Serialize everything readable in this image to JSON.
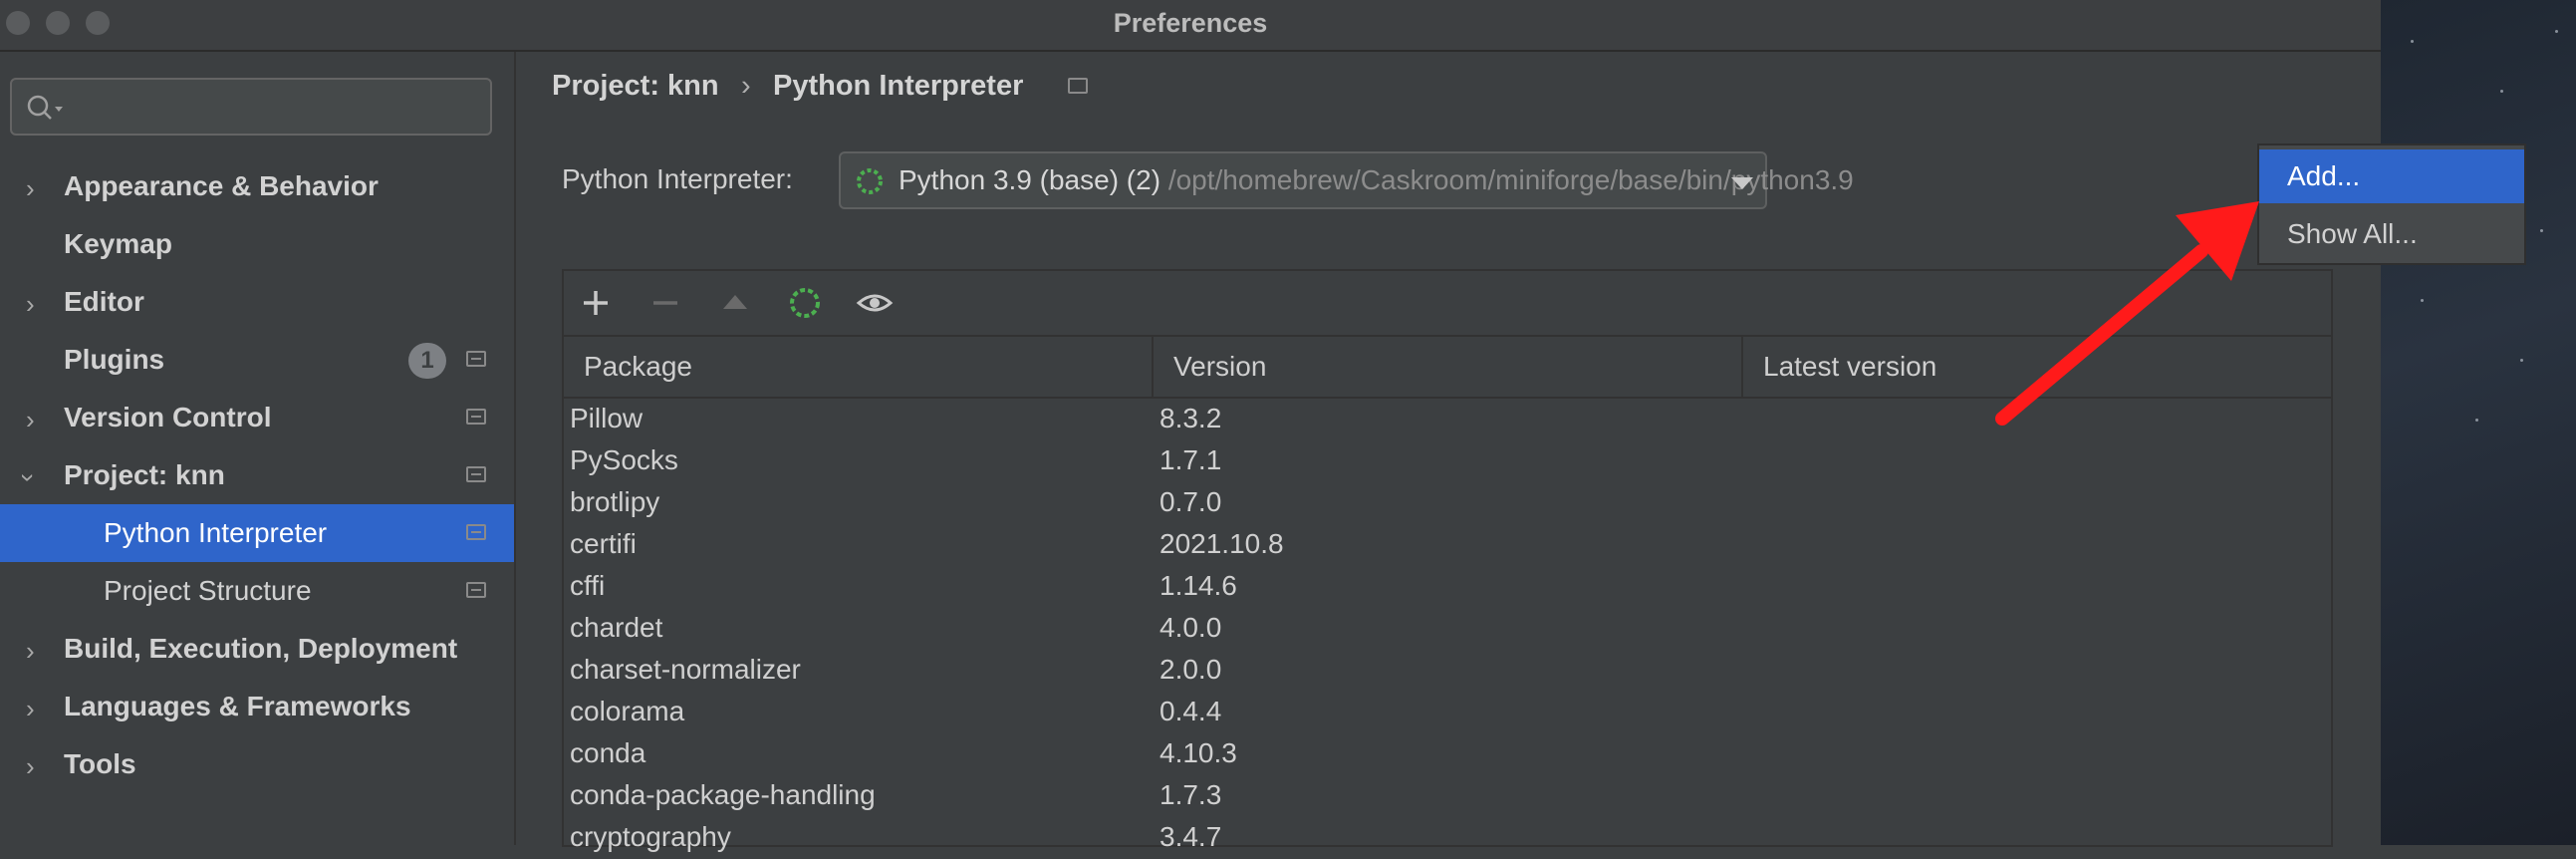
{
  "window": {
    "title": "Preferences"
  },
  "sidebar": {
    "search_placeholder": "",
    "items": [
      {
        "label": "Appearance & Behavior"
      },
      {
        "label": "Keymap"
      },
      {
        "label": "Editor"
      },
      {
        "label": "Plugins",
        "badge": "1"
      },
      {
        "label": "Version Control"
      },
      {
        "label": "Project: knn"
      },
      {
        "label": "Python Interpreter"
      },
      {
        "label": "Project Structure"
      },
      {
        "label": "Build, Execution, Deployment"
      },
      {
        "label": "Languages & Frameworks"
      },
      {
        "label": "Tools"
      }
    ]
  },
  "breadcrumb": {
    "parent": "Project: knn",
    "separator": "›",
    "current": "Python Interpreter"
  },
  "interpreter": {
    "label": "Python Interpreter:",
    "name": "Python 3.9 (base) (2)",
    "path": "/opt/homebrew/Caskroom/miniforge/base/bin/python3.9"
  },
  "popup": {
    "items": [
      "Add...",
      "Show All..."
    ]
  },
  "table": {
    "headers": [
      "Package",
      "Version",
      "Latest version"
    ],
    "rows": [
      [
        "Pillow",
        "8.3.2"
      ],
      [
        "PySocks",
        "1.7.1"
      ],
      [
        "brotlipy",
        "0.7.0"
      ],
      [
        "certifi",
        "2021.10.8"
      ],
      [
        "cffi",
        "1.14.6"
      ],
      [
        "chardet",
        "4.0.0"
      ],
      [
        "charset-normalizer",
        "2.0.0"
      ],
      [
        "colorama",
        "0.4.4"
      ],
      [
        "conda",
        "4.10.3"
      ],
      [
        "conda-package-handling",
        "1.7.3"
      ],
      [
        "cryptography",
        "3.4.7"
      ]
    ]
  },
  "colors": {
    "accent": "#2f65ca",
    "annotation_arrow": "#ff1a1a",
    "spinner": "#4caf50"
  },
  "icons": [
    "search-icon",
    "add-icon",
    "remove-icon",
    "upgrade-icon",
    "refresh-icon",
    "eye-icon",
    "chevron-right-icon",
    "chevron-down-icon",
    "project-scope-icon"
  ]
}
